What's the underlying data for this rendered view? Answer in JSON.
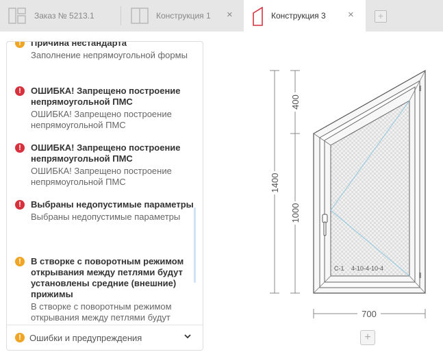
{
  "tabs": [
    {
      "label": "Заказ № 5213.1",
      "icon": "order-icon",
      "active": false
    },
    {
      "label": "Конструкция 1",
      "icon": "construction-icon",
      "active": false,
      "close": "×"
    },
    {
      "label": "Конструкция 3",
      "icon": "trapezoid-window-icon",
      "active": true,
      "close": "×"
    }
  ],
  "add_tab": "+",
  "messages": [
    {
      "type": "warning",
      "icon": "!",
      "title": "Причина нестандарта",
      "text": "Заполнение непрямоугольной формы"
    },
    {
      "type": "error",
      "icon": "!",
      "title": "ОШИБКА! Запрещено построение непрямоугольной ПМС",
      "text": "ОШИБКА! Запрещено построение непрямоугольной ПМС"
    },
    {
      "type": "error",
      "icon": "!",
      "title": "ОШИБКА! Запрещено построение непрямоугольной ПМС",
      "text": "ОШИБКА! Запрещено построение непрямоугольной ПМС"
    },
    {
      "type": "error",
      "icon": "!",
      "title": "Выбраны недопустимые параметры",
      "text": "Выбраны недопустимые параметры"
    },
    {
      "type": "warning",
      "icon": "!",
      "title": "В створке с поворотным режимом открывания между петлями будут установлены средние (внешние) прижимы",
      "text": "В створке с поворотным режимом открывания между петлями будут"
    }
  ],
  "footer": {
    "label": "Ошибки и предупреждения",
    "icon": "!",
    "chevron": "⌄"
  },
  "drawing": {
    "height_total": "1400",
    "height_top": "400",
    "height_bottom": "1000",
    "width": "700",
    "glass_label": "С-1",
    "glass_formula": "4-10-4-10-4",
    "colors": {
      "accent": "#d6313d",
      "warning": "#f0a524",
      "error": "#d6313d"
    }
  },
  "add_button": "+"
}
